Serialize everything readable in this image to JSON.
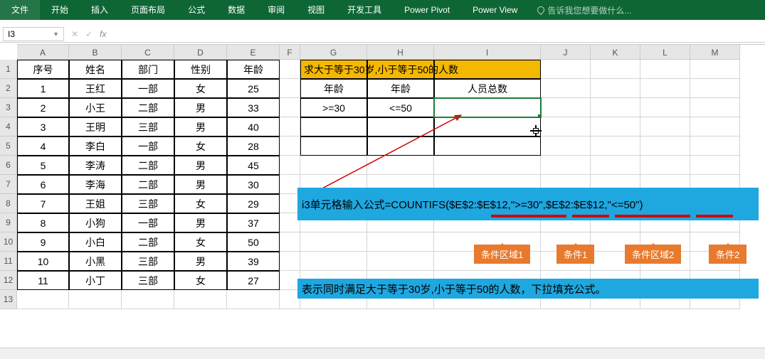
{
  "ribbon": {
    "tabs": [
      "文件",
      "开始",
      "插入",
      "页面布局",
      "公式",
      "数据",
      "审阅",
      "视图",
      "开发工具",
      "Power Pivot",
      "Power View"
    ],
    "tellme": "告诉我您想要做什么..."
  },
  "namebox": "I3",
  "columns": [
    "A",
    "B",
    "C",
    "D",
    "E",
    "F",
    "G",
    "H",
    "I",
    "J",
    "K",
    "L",
    "M"
  ],
  "rownums": [
    "1",
    "2",
    "3",
    "4",
    "5",
    "6",
    "7",
    "8",
    "9",
    "10",
    "11",
    "12",
    "13"
  ],
  "table": {
    "headers": [
      "序号",
      "姓名",
      "部门",
      "性别",
      "年龄"
    ],
    "rows": [
      [
        "1",
        "王红",
        "一部",
        "女",
        "25"
      ],
      [
        "2",
        "小王",
        "二部",
        "男",
        "33"
      ],
      [
        "3",
        "王明",
        "三部",
        "男",
        "40"
      ],
      [
        "4",
        "李白",
        "一部",
        "女",
        "28"
      ],
      [
        "5",
        "李涛",
        "二部",
        "男",
        "45"
      ],
      [
        "6",
        "李海",
        "二部",
        "男",
        "30"
      ],
      [
        "7",
        "王姐",
        "三部",
        "女",
        "29"
      ],
      [
        "8",
        "小狗",
        "一部",
        "男",
        "37"
      ],
      [
        "9",
        "小白",
        "二部",
        "女",
        "50"
      ],
      [
        "10",
        "小黑",
        "三部",
        "男",
        "39"
      ],
      [
        "11",
        "小丁",
        "三部",
        "女",
        "27"
      ]
    ]
  },
  "side": {
    "title": "求大于等于30岁,小于等于50的人数",
    "h1": "年龄",
    "h2": "年龄",
    "h3": "人员总数",
    "c1": ">=30",
    "c2": "<=50"
  },
  "formula_line": "i3单元格输入公式=COUNTIFS($E$2:$E$12,\">=30\",$E$2:$E$12,\"<=50\")",
  "explain": "表示同时满足大于等于30岁,小于等于50的人数，下拉填充公式。",
  "callouts": {
    "a": "条件区域1",
    "b": "条件1",
    "c": "条件区域2",
    "d": "条件2"
  }
}
